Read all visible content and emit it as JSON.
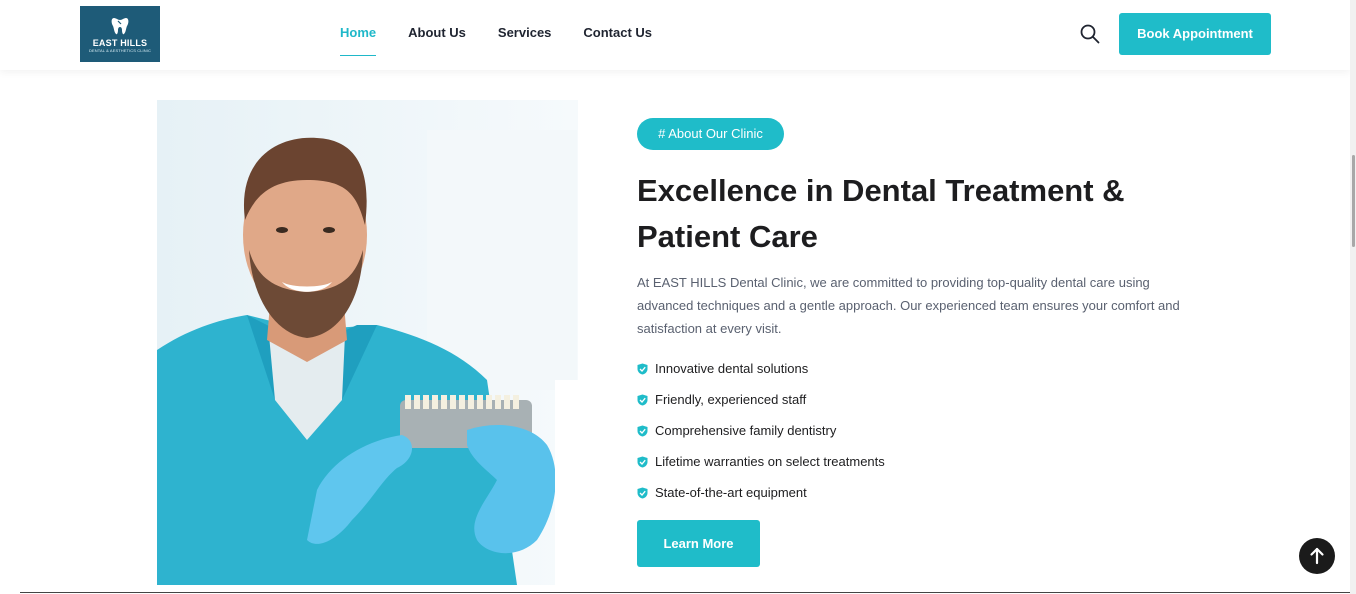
{
  "header": {
    "logo": {
      "name": "EAST HILLS",
      "sub": "DENTAL & AESTHETICS CLINIC"
    },
    "nav": [
      {
        "label": "Home",
        "active": true
      },
      {
        "label": "About Us",
        "active": false
      },
      {
        "label": "Services",
        "active": false
      },
      {
        "label": "Contact Us",
        "active": false
      }
    ],
    "search_icon": "search-icon",
    "book_label": "Book Appointment"
  },
  "about": {
    "tag": "# About Our Clinic",
    "title": "Excellence in Dental Treatment & Patient Care",
    "description": "At EAST HILLS Dental Clinic, we are committed to providing top-quality dental care using advanced techniques and a gentle approach. Our experienced team ensures your comfort and satisfaction at every visit.",
    "features": [
      "Innovative dental solutions",
      "Friendly, experienced staff",
      "Comprehensive family dentistry",
      "Lifetime warranties on select treatments",
      "State-of-the-art equipment"
    ],
    "learn_more_label": "Learn More"
  },
  "icons": {
    "feature_check": "shield-check-icon",
    "back_to_top": "arrow-up-icon"
  },
  "colors": {
    "accent": "#1fbcc9",
    "logo_bg": "#1e5b78",
    "text_dark": "#1d1d1f",
    "text_muted": "#5a6170"
  }
}
